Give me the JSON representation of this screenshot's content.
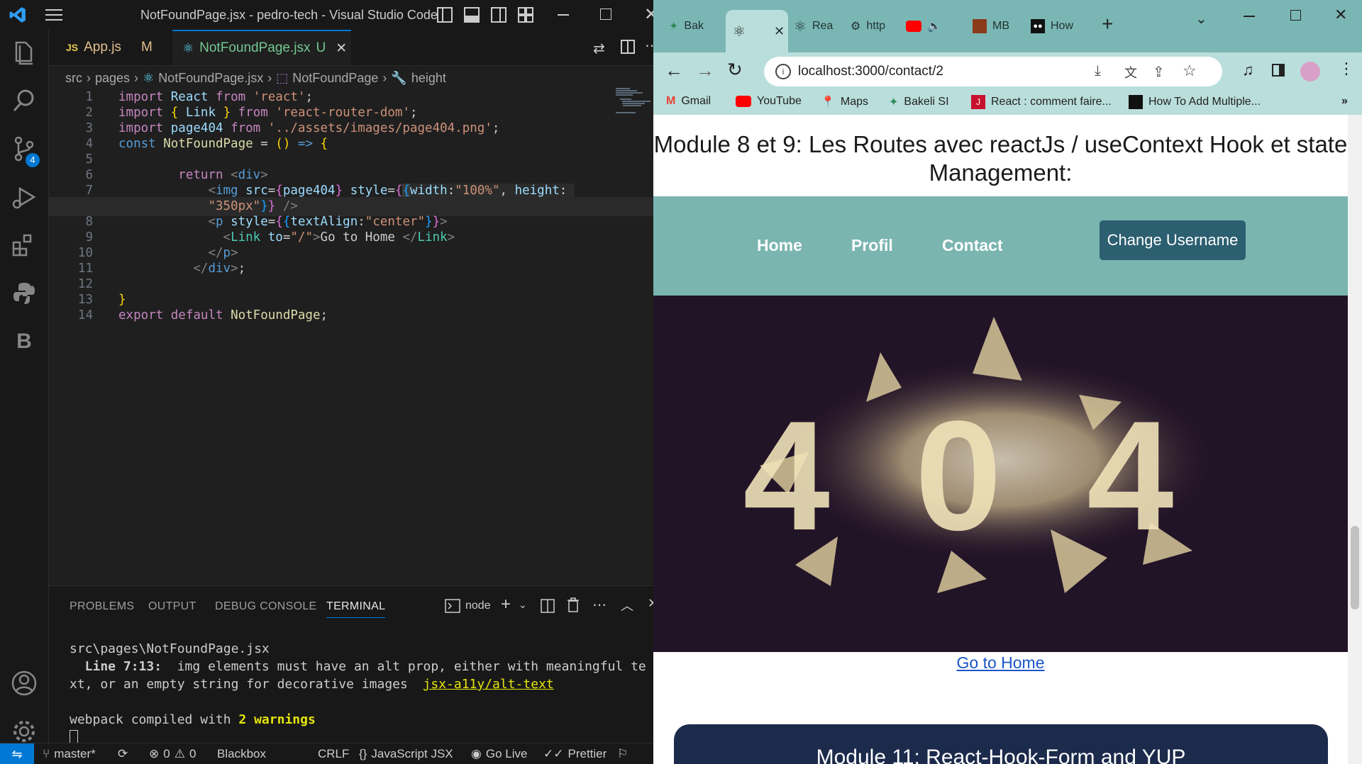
{
  "vscode": {
    "window_title": "NotFoundPage.jsx - pedro-tech - Visual Studio Code",
    "tabs": [
      {
        "lang": "JS",
        "label": "App.js",
        "status": "M"
      },
      {
        "label": "NotFoundPage.jsx",
        "status": "U"
      }
    ],
    "breadcrumb": [
      "src",
      "pages",
      "NotFoundPage.jsx",
      "NotFoundPage",
      "height"
    ],
    "line_numbers": [
      "1",
      "2",
      "3",
      "4",
      "5",
      "6",
      "7",
      "8",
      "9",
      "10",
      "11",
      "12",
      "13",
      "14"
    ],
    "activity_badge": "4",
    "panel_tabs": [
      "PROBLEMS",
      "OUTPUT",
      "DEBUG CONSOLE",
      "TERMINAL"
    ],
    "terminal_shell": "node",
    "terminal": {
      "file": "src\\pages\\NotFoundPage.jsx",
      "warning_loc": "  Line 7:13:",
      "warning_msg": "  img elements must have an alt prop, either with meaningful te",
      "warning_msg2": "xt, or an empty string for decorative images",
      "rule": "jsx-a11y/alt-text",
      "compiled_prefix": "webpack compiled with ",
      "compiled_count": "2 warnings"
    },
    "status": {
      "branch": "master*",
      "errors": "0",
      "warnings": "0",
      "blackbox": "Blackbox",
      "eol": "CRLF",
      "language": "JavaScript JSX",
      "golive": "Go Live",
      "prettier": "Prettier"
    }
  },
  "chrome": {
    "tabs": [
      {
        "label": "Bak"
      },
      {
        "label": ""
      },
      {
        "label": "Rea"
      },
      {
        "label": "http"
      },
      {
        "label": ""
      },
      {
        "label": "MB"
      },
      {
        "label": "How"
      }
    ],
    "url": "localhost:3000/contact/2",
    "bookmarks": [
      "Gmail",
      "YouTube",
      "Maps",
      "Bakeli SI",
      "React : comment faire...",
      "How To Add Multiple..."
    ],
    "page": {
      "module_title_line1": "Module 8 et 9: Les Routes avec reactJs / useContext Hook et state",
      "module_title_line2": "Management:",
      "nav": [
        "Home",
        "Profil",
        "Contact"
      ],
      "change_username": "Change Username",
      "image_text": "404",
      "go_home": "Go to Home",
      "module11": "Module 11: React-Hook-Form and YUP"
    }
  },
  "colors": {
    "vscode_bg": "#1f1f1f",
    "chrome_tab_bg": "#7ab7b4",
    "nav_bg": "#7ab5b0",
    "button_bg": "#2c5f70",
    "link": "#1a55c9",
    "module11_bg": "#1c2a4b"
  }
}
